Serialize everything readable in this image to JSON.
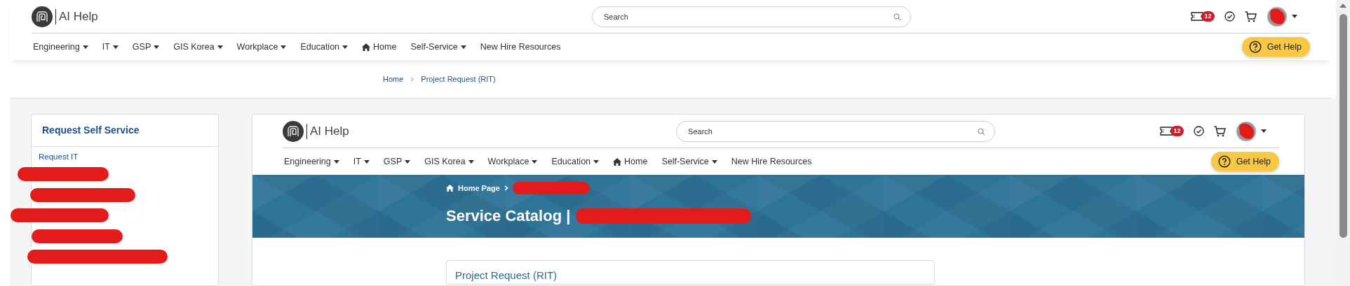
{
  "header": {
    "brand": "AI Help",
    "search": {
      "placeholder": "Search"
    },
    "ticket_badge": "12",
    "nav": [
      {
        "label": "Engineering",
        "kind": "dropdown"
      },
      {
        "label": "IT",
        "kind": "dropdown"
      },
      {
        "label": "GSP",
        "kind": "dropdown"
      },
      {
        "label": "GIS Korea",
        "kind": "dropdown"
      },
      {
        "label": "Workplace",
        "kind": "dropdown"
      },
      {
        "label": "Education",
        "kind": "dropdown"
      },
      {
        "label": "Home",
        "kind": "home"
      },
      {
        "label": "Self-Service",
        "kind": "dropdown"
      },
      {
        "label": "New Hire Resources",
        "kind": "link"
      }
    ],
    "get_help": "Get Help"
  },
  "breadcrumb": [
    "Home",
    "Project Request (RIT)"
  ],
  "sidebar": {
    "title": "Request Self Service",
    "items": [
      "Request IT"
    ]
  },
  "embedded_page": {
    "header": {
      "brand": "AI Help",
      "search": {
        "placeholder": "Search"
      },
      "ticket_badge": "12",
      "nav": [
        {
          "label": "Engineering",
          "kind": "dropdown"
        },
        {
          "label": "IT",
          "kind": "dropdown"
        },
        {
          "label": "GSP",
          "kind": "dropdown"
        },
        {
          "label": "GIS Korea",
          "kind": "dropdown"
        },
        {
          "label": "Workplace",
          "kind": "dropdown"
        },
        {
          "label": "Education",
          "kind": "dropdown"
        },
        {
          "label": "Home",
          "kind": "home"
        },
        {
          "label": "Self-Service",
          "kind": "dropdown"
        },
        {
          "label": "New Hire Resources",
          "kind": "link"
        }
      ],
      "get_help": "Get Help"
    },
    "banner": {
      "breadcrumb": "Home Page",
      "title": "Service Catalog |"
    },
    "card": {
      "title": "Project Request (RIT)"
    }
  }
}
